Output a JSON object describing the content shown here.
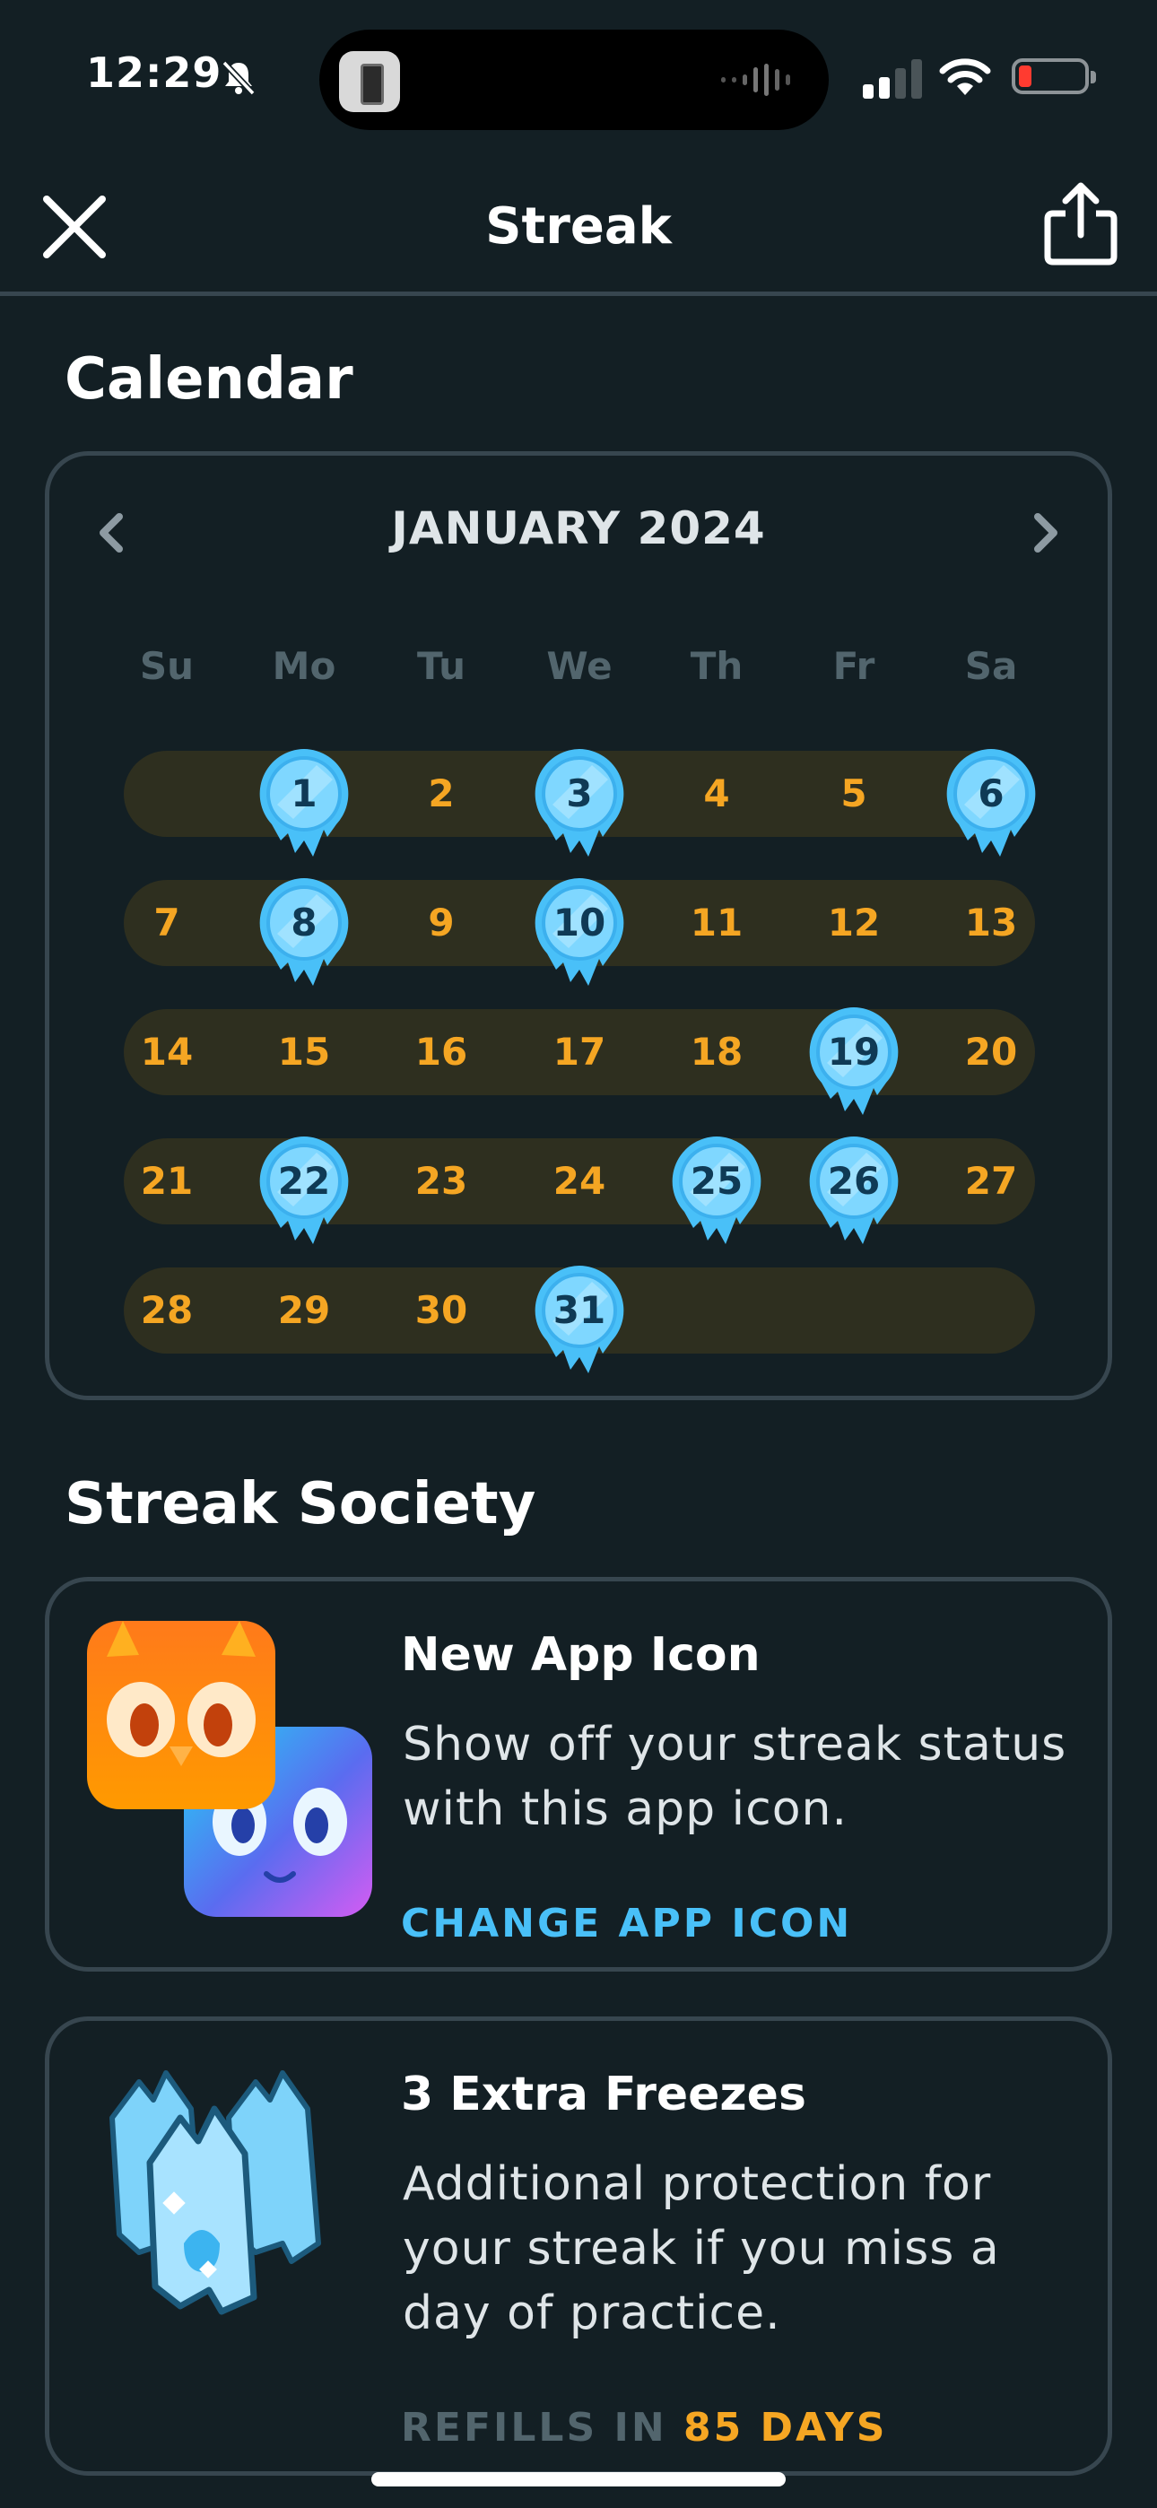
{
  "status_bar": {
    "time": "12:29",
    "icons": [
      "bell-slash-icon",
      "signal-icon",
      "wifi-icon",
      "battery-low-icon"
    ]
  },
  "header": {
    "title": "Streak",
    "close_icon": "close-icon",
    "share_icon": "share-icon"
  },
  "calendar": {
    "section_title": "Calendar",
    "month_label": "JANUARY 2024",
    "weekdays": [
      "Su",
      "Mo",
      "Tu",
      "We",
      "Th",
      "Fr",
      "Sa"
    ],
    "weeks": [
      [
        null,
        "1",
        "2",
        "3",
        "4",
        "5",
        "6"
      ],
      [
        "7",
        "8",
        "9",
        "10",
        "11",
        "12",
        "13"
      ],
      [
        "14",
        "15",
        "16",
        "17",
        "18",
        "19",
        "20"
      ],
      [
        "21",
        "22",
        "23",
        "24",
        "25",
        "26",
        "27"
      ],
      [
        "28",
        "29",
        "30",
        "31",
        null,
        null,
        null
      ]
    ],
    "frozen_days": [
      "1",
      "3",
      "6",
      "8",
      "10",
      "19",
      "22",
      "25",
      "26",
      "31"
    ],
    "colors": {
      "practiced": "#f5a623",
      "frozen": "#49c0f8",
      "band": "#2e2f1f"
    }
  },
  "society": {
    "section_title": "Streak Society",
    "app_icon_card": {
      "title": "New App Icon",
      "description": "Show off your streak status with this app icon.",
      "action_label": "CHANGE APP ICON"
    },
    "freezes_card": {
      "title": "3 Extra Freezes",
      "description": "Additional protection for your streak if you miss a day of practice.",
      "refill_prefix": "REFILLS IN",
      "refill_value": "85 DAYS"
    }
  },
  "colors": {
    "background": "#131f24",
    "border": "#37464f",
    "accent_blue": "#49c0f8",
    "accent_orange": "#f5a623"
  }
}
